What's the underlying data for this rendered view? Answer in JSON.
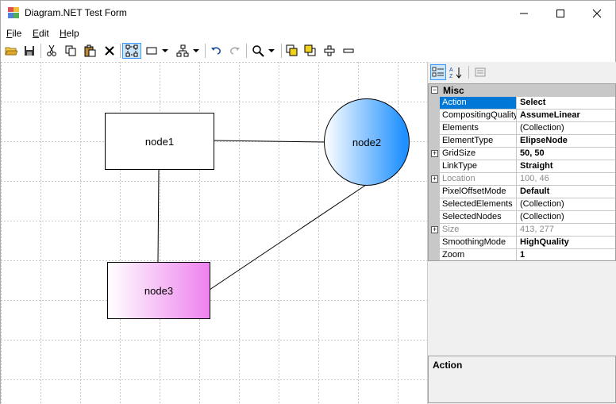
{
  "window": {
    "title": "Diagram.NET Test Form"
  },
  "menu": [
    {
      "underline": "F",
      "rest": "ile"
    },
    {
      "underline": "E",
      "rest": "dit"
    },
    {
      "underline": "H",
      "rest": "elp"
    }
  ],
  "toolbar": {
    "icons": [
      "open-icon",
      "save-icon",
      "cut-icon",
      "copy-icon",
      "paste-icon",
      "delete-icon",
      "select-tool-icon",
      "rectangle-tool-icon",
      "connector-tool-icon",
      "undo-icon",
      "redo-icon",
      "zoom-icon",
      "bring-to-front-icon",
      "send-to-back-icon",
      "add-icon",
      "remove-icon"
    ]
  },
  "diagram": {
    "nodes": [
      {
        "id": "node1",
        "label": "node1",
        "shape": "rectangle",
        "fill": "#ffffff"
      },
      {
        "id": "node2",
        "label": "node2",
        "shape": "ellipse",
        "fill_from": "#ffffff",
        "fill_to": "#1e90ff"
      },
      {
        "id": "node3",
        "label": "node3",
        "shape": "rectangle",
        "fill_from": "#ffffff",
        "fill_to": "#ee82ee"
      }
    ],
    "links": [
      {
        "from": "node1",
        "to": "node2"
      },
      {
        "from": "node1",
        "to": "node3"
      },
      {
        "from": "node2",
        "to": "node3"
      }
    ],
    "grid_color": "#c8c8c8"
  },
  "property_grid": {
    "category": "Misc",
    "properties": [
      {
        "name": "Action",
        "value": "Select",
        "bold": true,
        "selected": true,
        "expandable": false,
        "readonly": false
      },
      {
        "name": "CompositingQuality",
        "value": "AssumeLinear",
        "bold": true,
        "selected": false,
        "expandable": false,
        "readonly": false
      },
      {
        "name": "Elements",
        "value": "(Collection)",
        "bold": false,
        "selected": false,
        "expandable": false,
        "readonly": false
      },
      {
        "name": "ElementType",
        "value": "ElipseNode",
        "bold": true,
        "selected": false,
        "expandable": false,
        "readonly": false
      },
      {
        "name": "GridSize",
        "value": "50, 50",
        "bold": true,
        "selected": false,
        "expandable": true,
        "readonly": false
      },
      {
        "name": "LinkType",
        "value": "Straight",
        "bold": true,
        "selected": false,
        "expandable": false,
        "readonly": false
      },
      {
        "name": "Location",
        "value": "100, 46",
        "bold": false,
        "selected": false,
        "expandable": true,
        "readonly": true
      },
      {
        "name": "PixelOffsetMode",
        "value": "Default",
        "bold": true,
        "selected": false,
        "expandable": false,
        "readonly": false
      },
      {
        "name": "SelectedElements",
        "value": "(Collection)",
        "bold": false,
        "selected": false,
        "expandable": false,
        "readonly": false
      },
      {
        "name": "SelectedNodes",
        "value": "(Collection)",
        "bold": false,
        "selected": false,
        "expandable": false,
        "readonly": false
      },
      {
        "name": "Size",
        "value": "413, 277",
        "bold": false,
        "selected": false,
        "expandable": true,
        "readonly": true
      },
      {
        "name": "SmoothingMode",
        "value": "HighQuality",
        "bold": true,
        "selected": false,
        "expandable": false,
        "readonly": false
      },
      {
        "name": "Zoom",
        "value": "1",
        "bold": true,
        "selected": false,
        "expandable": false,
        "readonly": false
      }
    ],
    "help_title": "Action"
  },
  "colors": {
    "selection": "#0078d7",
    "toolbar_selected": "#cce4f7"
  }
}
